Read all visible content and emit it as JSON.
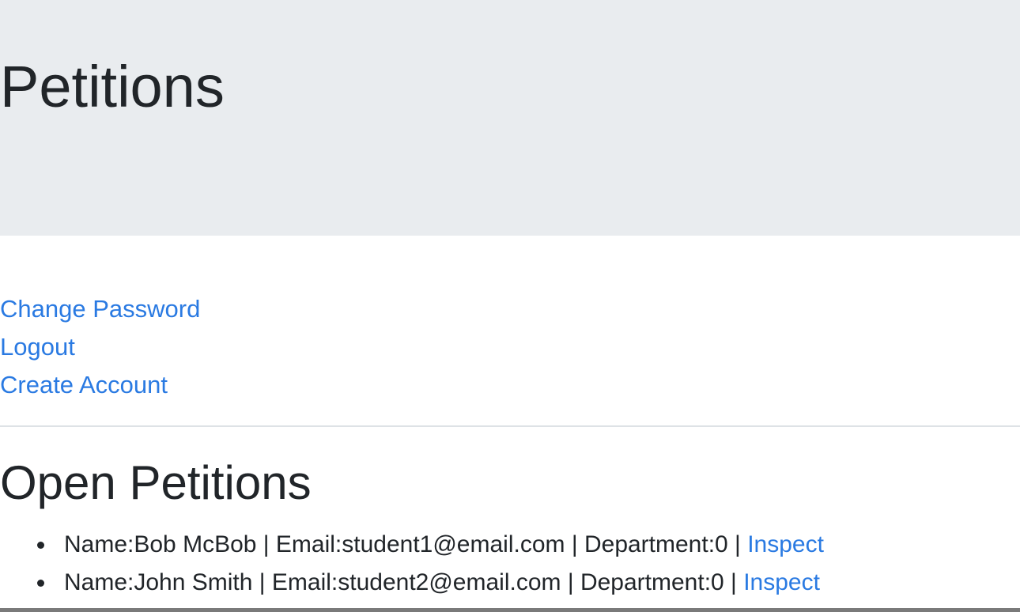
{
  "header": {
    "title": "Petitions"
  },
  "nav": {
    "change_password": "Change Password",
    "logout": "Logout",
    "create_account": "Create Account"
  },
  "open_petitions": {
    "title": "Open Petitions",
    "items": [
      {
        "details": "Name:Bob McBob | Email:student1@email.com | Department:0 | ",
        "action": "Inspect"
      },
      {
        "details": "Name:John Smith | Email:student2@email.com | Department:0 | ",
        "action": "Inspect"
      }
    ]
  },
  "colors": {
    "jumbotron_bg": "#e9ecef",
    "link": "#2a7ae2",
    "text": "#212529"
  }
}
